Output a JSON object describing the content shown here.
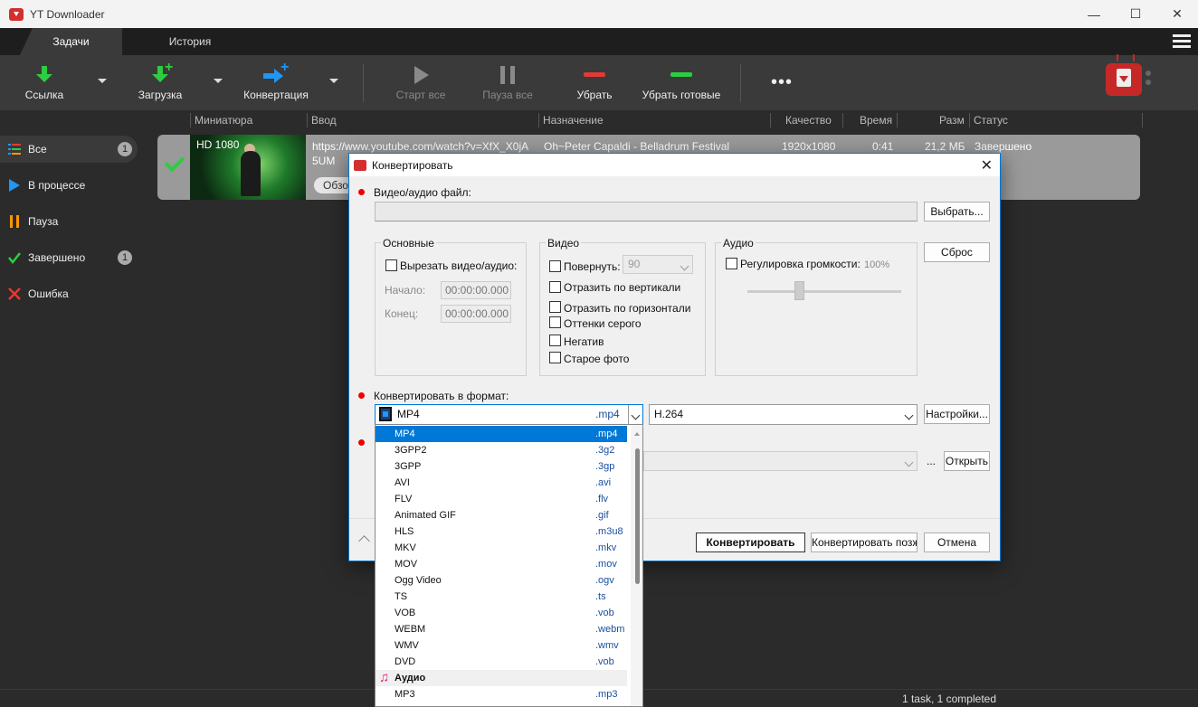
{
  "window": {
    "title": "YT Downloader",
    "minimize": "—",
    "maximize": "☐",
    "close": "✕"
  },
  "tabs": [
    {
      "label": "Задачи"
    },
    {
      "label": "История"
    }
  ],
  "toolbar": {
    "link": "Ссылка",
    "download": "Загрузка",
    "convert": "Конвертация",
    "start_all": "Старт все",
    "pause_all": "Пауза все",
    "remove": "Убрать",
    "remove_done": "Убрать готовые",
    "more": "•••"
  },
  "sidebar": {
    "items": [
      {
        "label": "Все",
        "count": "1"
      },
      {
        "label": "В процессе"
      },
      {
        "label": "Пауза"
      },
      {
        "label": "Завершено",
        "count": "1"
      },
      {
        "label": "Ошибка"
      }
    ]
  },
  "columns": {
    "thumbnail": "Миниатюра",
    "input": "Ввод",
    "destination": "Назначение",
    "quality": "Качество",
    "time": "Время",
    "size": "Разм",
    "status": "Статус"
  },
  "task": {
    "badge": "HD 1080",
    "url_line1": "https://www.youtube.com/watch?v=XfX_X0jA",
    "url_line2": "5UM",
    "destination": "Oh~Peter Capaldi - Belladrum Festival",
    "quality": "1920x1080",
    "time": "0:41",
    "size": "21,2 МБ",
    "status": "Завершено",
    "browse": "Обзо"
  },
  "statusbar": {
    "text": "1 task, 1 completed"
  },
  "dialog": {
    "title": "Конвертировать",
    "file_label": "Видео/аудио файл:",
    "choose_button": "Выбрать...",
    "reset_button": "Сброс",
    "basic": {
      "title": "Основные",
      "cut_label": "Вырезать видео/аудио:",
      "start_label": "Начало:",
      "start_value": "00:00:00.000",
      "end_label": "Конец:",
      "end_value": "00:00:00.000"
    },
    "video": {
      "title": "Видео",
      "rotate_label": "Повернуть:",
      "rotate_value": "90",
      "flip_v": "Отразить по вертикали",
      "flip_h": "Отразить по горизонтали",
      "grayscale": "Оттенки серого",
      "negative": "Негатив",
      "old_photo": "Старое фото"
    },
    "audio": {
      "title": "Аудио",
      "volume_label": "Регулировка громкости:",
      "volume_value": "100%"
    },
    "format_label": "Конвертировать в формат:",
    "format_name": "MP4",
    "format_ext": ".mp4",
    "codec": "H.264",
    "settings_button": "Настройки...",
    "browse_dots": "...",
    "open_button": "Открыть",
    "convert_button": "Конвертировать",
    "convert_later_button": "Конвертировать позже",
    "cancel_button": "Отмена"
  },
  "format_list": [
    {
      "name": "MP4",
      "ext": ".mp4"
    },
    {
      "name": "3GPP2",
      "ext": ".3g2"
    },
    {
      "name": "3GPP",
      "ext": ".3gp"
    },
    {
      "name": "AVI",
      "ext": ".avi"
    },
    {
      "name": "FLV",
      "ext": ".flv"
    },
    {
      "name": "Animated GIF",
      "ext": ".gif"
    },
    {
      "name": "HLS",
      "ext": ".m3u8"
    },
    {
      "name": "MKV",
      "ext": ".mkv"
    },
    {
      "name": "MOV",
      "ext": ".mov"
    },
    {
      "name": "Ogg Video",
      "ext": ".ogv"
    },
    {
      "name": "TS",
      "ext": ".ts"
    },
    {
      "name": "VOB",
      "ext": ".vob"
    },
    {
      "name": "WEBM",
      "ext": ".webm"
    },
    {
      "name": "WMV",
      "ext": ".wmv"
    },
    {
      "name": "DVD",
      "ext": ".vob"
    },
    {
      "name": "Аудио"
    },
    {
      "name": "MP3",
      "ext": ".mp3"
    }
  ]
}
